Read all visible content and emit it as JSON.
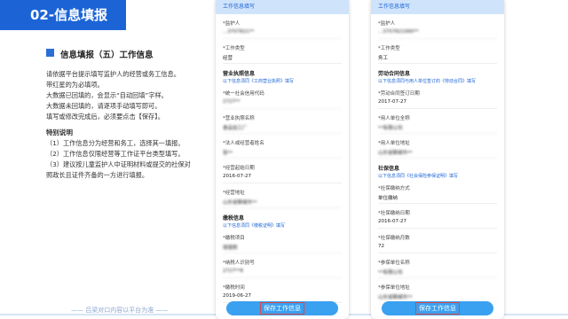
{
  "banner": "02-信息填报",
  "section": "信息填报（五）工作信息",
  "intro": [
    "请依据平台提示填写监护人的经营或务工信息。",
    "带红星的为必填项。",
    "大数据已回填的，会显示“自动回填”字样。",
    "大数据未回填的，请逐项手动填写即可。",
    "填写或修改完成后，必须要点击【保存】。"
  ],
  "notes_title": "特别说明",
  "notes": [
    "（1）工作信息分为经营和务工，选择其一填报。",
    "（2）工作信息仅限经营等工作证平台类型填写。",
    "（3）建议按儿童监护人中证明材料或提交的社保对",
    "照政长且证件齐备的一方进行填报。"
  ],
  "footer": "—— 吕梁对口内容以平台为准 ——",
  "phone1": {
    "header": "工作信息填写",
    "fields": [
      {
        "label": "*监护人",
        "value": "...3707821**",
        "blur": true
      },
      {
        "label": "*工作类型",
        "value": "经营",
        "blur": false
      }
    ],
    "sub1_title": "营业执照信息",
    "sub1_hint": "以下信息须同《工商营业执照》填写",
    "fields2": [
      {
        "label": "*统一社会信用代码",
        "value": "2727**",
        "blur": true
      },
      {
        "label": "*营业执照名称",
        "value": "食品加工厂",
        "blur": true
      },
      {
        "label": "*法人或经营者姓名",
        "value": "张**",
        "blur": true
      },
      {
        "label": "*经营起始日期",
        "value": "2016-07-27",
        "blur": false
      },
      {
        "label": "*经营地址",
        "value": "山东省聊城市**",
        "blur": true
      }
    ],
    "sub2_title": "缴税信息",
    "sub2_hint": "以下信息须同《缴税证明》填写",
    "fields3": [
      {
        "label": "*缴税项目",
        "value": "增值税",
        "blur": true
      },
      {
        "label": "*纳税人识别号",
        "value": "2727**8",
        "blur": true
      },
      {
        "label": "*缴税时间",
        "value": "2019-06-27",
        "blur": false
      }
    ],
    "save": "保存工作信息"
  },
  "phone2": {
    "header": "工作信息填写",
    "fields": [
      {
        "label": "*监护人",
        "value": "...3707821990**",
        "blur": true
      },
      {
        "label": "*工作类型",
        "value": "务工",
        "blur": false
      }
    ],
    "sub1_title": "劳动合同信息",
    "sub1_hint": "以下信息须同与用人单位签订的《劳动合同》填写",
    "fields2": [
      {
        "label": "*劳动合同签订日期",
        "value": "2017-07-27",
        "blur": false
      },
      {
        "label": "*用人单位全称",
        "value": "**有限公司",
        "blur": true
      },
      {
        "label": "*用人单位地址",
        "value": "山东省聊城市**",
        "blur": true
      }
    ],
    "sub2_title": "社保信息",
    "sub2_hint": "以下信息须同《社会保险参保证明》填写",
    "fields3": [
      {
        "label": "*社保缴纳方式",
        "value": "单位缴纳",
        "blur": false
      },
      {
        "label": "*社保缴纳日期",
        "value": "2016-07-27",
        "blur": false
      },
      {
        "label": "*社保缴纳月数",
        "value": "72",
        "blur": false
      },
      {
        "label": "*参保单位名称",
        "value": "**有限公司",
        "blur": true
      },
      {
        "label": "*参保单位地址",
        "value": "山东省聊城市**",
        "blur": true
      }
    ],
    "save": "保存工作信息"
  }
}
